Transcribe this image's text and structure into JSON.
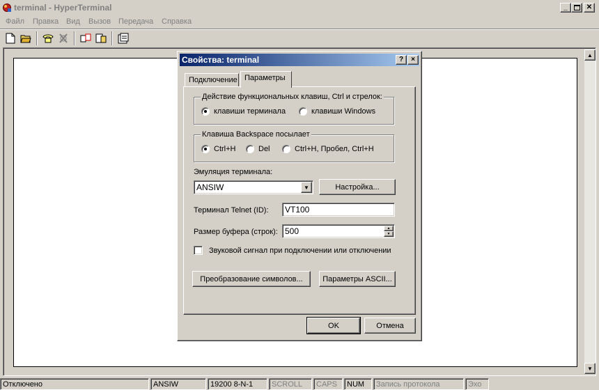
{
  "window": {
    "title": "terminal - HyperTerminal"
  },
  "menu": [
    "Файл",
    "Правка",
    "Вид",
    "Вызов",
    "Передача",
    "Справка"
  ],
  "toolbar": [
    "new-icon",
    "open-icon",
    "dial-icon",
    "hangup-icon",
    "send-icon",
    "receive-icon",
    "properties-icon"
  ],
  "dialog": {
    "title": "Свойства: terminal",
    "help": "?",
    "close": "×",
    "tabs": [
      "Подключение",
      "Параметры"
    ],
    "active_tab": "Параметры",
    "keys_group": {
      "legend": "Действие функциональных клавиш, Ctrl и стрелок:",
      "options": [
        "клавиши терминала",
        "клавиши Windows"
      ],
      "selected": "клавиши терминала"
    },
    "backspace_group": {
      "legend": "Клавиша  Backspace посылает",
      "options": [
        "Ctrl+H",
        "Del",
        "Ctrl+H, Пробел, Ctrl+H"
      ],
      "selected": "Ctrl+H"
    },
    "emulation": {
      "label": "Эмуляция терминала:",
      "value": "ANSIW",
      "setup_button": "Настройка..."
    },
    "telnet": {
      "label": "Терминал Telnet (ID):",
      "value": "VT100"
    },
    "buffer": {
      "label": "Размер буфера (строк):",
      "value": "500"
    },
    "sound": {
      "label": "Звуковой сигнал при подключении или отключении",
      "checked": false
    },
    "charset_button": "Преобразование символов...",
    "ascii_button": "Параметры ASCII...",
    "ok_button": "OK",
    "cancel_button": "Отмена"
  },
  "status": {
    "connection": "Отключено",
    "emulation": "ANSIW",
    "settings": "19200 8-N-1",
    "scroll": "SCROLL",
    "caps": "CAPS",
    "num": "NUM",
    "log": "Запись протокола",
    "echo": "Эхо"
  }
}
